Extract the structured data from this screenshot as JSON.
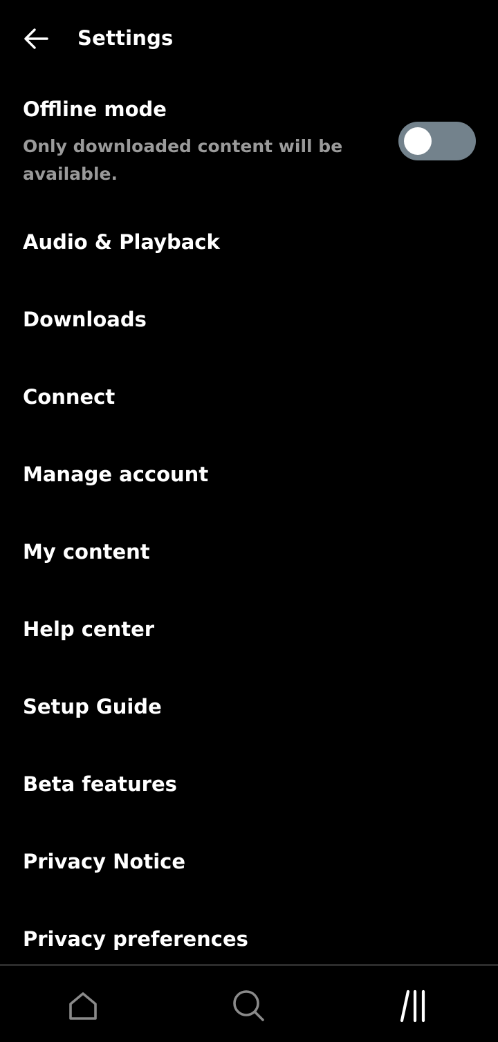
{
  "header": {
    "title": "Settings",
    "back_icon": "arrow-left-icon"
  },
  "offline_mode": {
    "title": "Offline mode",
    "description": "Only downloaded content will be available.",
    "enabled": false,
    "toggle_off_color": "#73828c"
  },
  "menu": {
    "items": [
      {
        "label": "Audio & Playback"
      },
      {
        "label": "Downloads"
      },
      {
        "label": "Connect"
      },
      {
        "label": "Manage account"
      },
      {
        "label": "My content"
      },
      {
        "label": "Help center"
      },
      {
        "label": "Setup Guide"
      },
      {
        "label": "Beta features"
      },
      {
        "label": "Privacy Notice"
      },
      {
        "label": "Privacy preferences"
      }
    ]
  },
  "bottom_nav": {
    "items": [
      {
        "icon": "home-icon",
        "active": false
      },
      {
        "icon": "search-icon",
        "active": false
      },
      {
        "icon": "library-icon",
        "active": true
      }
    ]
  },
  "colors": {
    "background": "#000000",
    "text": "#ffffff",
    "secondary_text": "#9a9a9a",
    "inactive_icon": "#8a8a8a"
  }
}
